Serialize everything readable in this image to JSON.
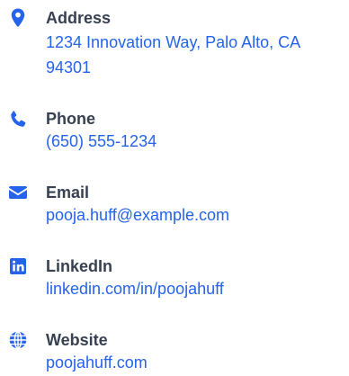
{
  "accent_color": "#2563eb",
  "text_color": "#374151",
  "contacts": [
    {
      "icon": "map-pin-icon",
      "label": "Address",
      "value": "1234 Innovation Way, Palo Alto, CA 94301"
    },
    {
      "icon": "phone-icon",
      "label": "Phone",
      "value": "(650) 555-1234"
    },
    {
      "icon": "envelope-icon",
      "label": "Email",
      "value": "pooja.huff@example.com"
    },
    {
      "icon": "linkedin-icon",
      "label": "LinkedIn",
      "value": "linkedin.com/in/poojahuff"
    },
    {
      "icon": "globe-icon",
      "label": "Website",
      "value": "poojahuff.com"
    }
  ]
}
